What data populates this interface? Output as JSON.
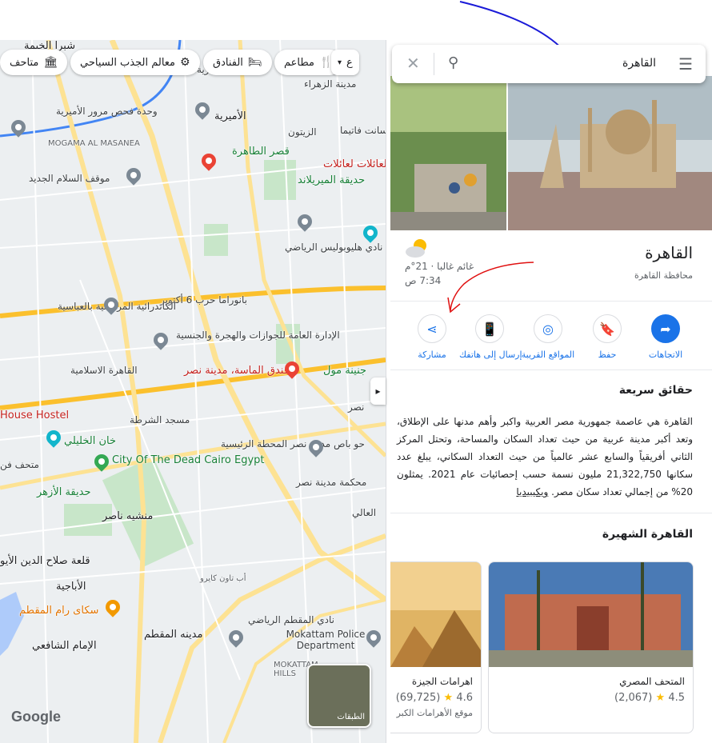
{
  "search": {
    "query": "القاهرة"
  },
  "place": {
    "name": "القاهرة",
    "subtitle": "محافظة القاهرة",
    "weather": "غائم غالبا · 21°م",
    "time": "7:34 ص"
  },
  "actions": [
    {
      "label": "الاتجاهات"
    },
    {
      "label": "حفظ"
    },
    {
      "label": "المواقع القريبة"
    },
    {
      "label": "إرسال إلى هاتفك"
    },
    {
      "label": "مشاركة"
    }
  ],
  "facts": {
    "heading": "حقائق سريعة",
    "body": "القاهرة هي عاصمة جمهورية مصر العربية واكبر وأهم مدنها على الإطلاق، وتعد أكبر مدينة عربية من حيث تعداد السكان والمساحة، وتحتل المركز الثاني أفريقياً والسابع عشر عالمياً من حيث التعداد السكاني، يبلغ عدد سكانها 21,322,750 مليون نسمة حسب إحصائيات عام 2021. يمثلون 20% من إجمالي تعداد سكان مصر.",
    "source": "ويكيبيديا"
  },
  "famous": {
    "heading": "القاهرة الشهيرة",
    "cards": [
      {
        "name": "المتحف المصري",
        "rating": "4.5",
        "count": "(2,067)",
        "type": ""
      },
      {
        "name": "اهرامات الجيزة",
        "rating": "4.6",
        "count": "(69,725)",
        "type": "موقع الأهرامات الكبر"
      }
    ]
  },
  "chips": [
    {
      "label": "متاحف",
      "icon": "museum-icon"
    },
    {
      "label": "معالم الجذب السياحي",
      "icon": "attraction-icon"
    },
    {
      "label": "الفنادق",
      "icon": "hotel-icon"
    },
    {
      "label": "مطاعم",
      "icon": "restaurant-icon"
    },
    {
      "label": "ع",
      "icon": "more-icon"
    }
  ],
  "map": {
    "labels": [
      "شبرا الخيمة",
      "ميدان المطرية",
      "مدينة الزهراء",
      "وحدة فحص مرور الأميرية",
      "الأميرية",
      "الزيتون",
      "سانت فاتيما",
      "MOGAMA AL MASANEA",
      "قصر الطاهرة",
      "العائلات لعائلات",
      "موقف السلام الجديد",
      "حديقة الميريلاند",
      "نادي هليوبوليس الرياضي",
      "بانوراما حرب 6 أكتوبر",
      "الكاتدرائية المرقسية بالعباسية",
      "الإدارة العامة للجوازات والهجرة والجنسية",
      "فندق الماسة، مدينة نصر",
      "جنينة مول",
      "القاهرة الاسلامية",
      "House Hostel",
      "مسجد الشرطة",
      "خان الخليلي",
      "City Of The Dead Cairo Egypt",
      "حديقة الأزهر",
      "متحف فن",
      "حو باص مدينة نصر المحطة الرئيسية",
      "محكمة مدينة نصر",
      "منشيه ناصر",
      "قلعة صلاح الدين الأيو",
      "الأباجية",
      "سكاى رام المقطم",
      "أب تاون كايرو",
      "نادي المقطم الرياضي",
      "مدينه المقطم",
      "الإمام الشافعي",
      "Mokattam Police Department",
      "MOKATTAM HILLS",
      "نصر",
      "العالي"
    ],
    "layers_label": "الطبقات",
    "logo": "Google"
  },
  "colors": {
    "accent": "#1a73e8",
    "road": "#fde293",
    "park": "#c8e6c9"
  }
}
